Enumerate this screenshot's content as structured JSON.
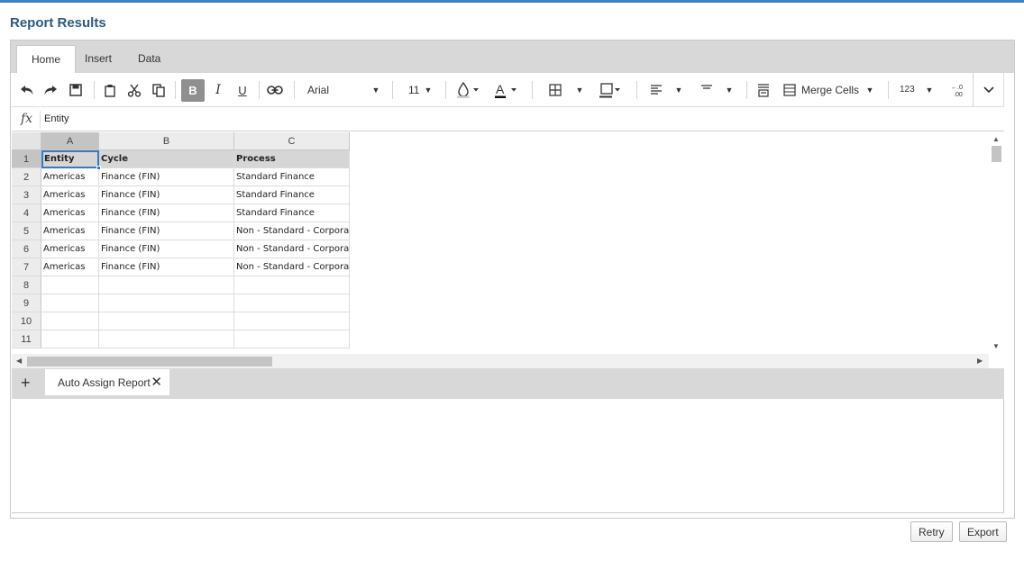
{
  "page": {
    "title": "Report Results"
  },
  "ribbon": {
    "tabs": [
      "Home",
      "Insert",
      "Data"
    ],
    "active_tab": "Home"
  },
  "toolbar": {
    "font_name": "Arial",
    "font_size": "11",
    "merge_label": "Merge Cells",
    "number_format_label": "123",
    "bold_label": "B",
    "italic_label": "I",
    "underline_label": "U",
    "decimal_label": "←.0 .00"
  },
  "formula_bar": {
    "label": "fx",
    "value": "Entity"
  },
  "sheet": {
    "columns": [
      "A",
      "B",
      "C"
    ],
    "row_numbers": [
      "1",
      "2",
      "3",
      "4",
      "5",
      "6",
      "7",
      "8",
      "9",
      "10",
      "11"
    ],
    "selected_cell": "A1",
    "rows": [
      [
        "Entity",
        "Cycle",
        "Process"
      ],
      [
        "Americas",
        "Finance (FIN)",
        "Standard Finance"
      ],
      [
        "Americas",
        "Finance (FIN)",
        "Standard Finance"
      ],
      [
        "Americas",
        "Finance (FIN)",
        "Standard Finance"
      ],
      [
        "Americas",
        "Finance (FIN)",
        "Non - Standard - Corporate"
      ],
      [
        "Americas",
        "Finance (FIN)",
        "Non - Standard - Corporate"
      ],
      [
        "Americas",
        "Finance (FIN)",
        "Non - Standard - Corporate"
      ],
      [
        "",
        "",
        ""
      ],
      [
        "",
        "",
        ""
      ],
      [
        "",
        "",
        ""
      ],
      [
        "",
        "",
        ""
      ]
    ]
  },
  "sheet_tabs": {
    "add_label": "+",
    "tabs": [
      {
        "label": "Auto Assign Report"
      }
    ],
    "close_label": "✕"
  },
  "actions": {
    "retry": "Retry",
    "export": "Export"
  },
  "colors": {
    "accent": "#3b82c4",
    "title": "#2a5b84",
    "selection": "#3b78c4"
  }
}
